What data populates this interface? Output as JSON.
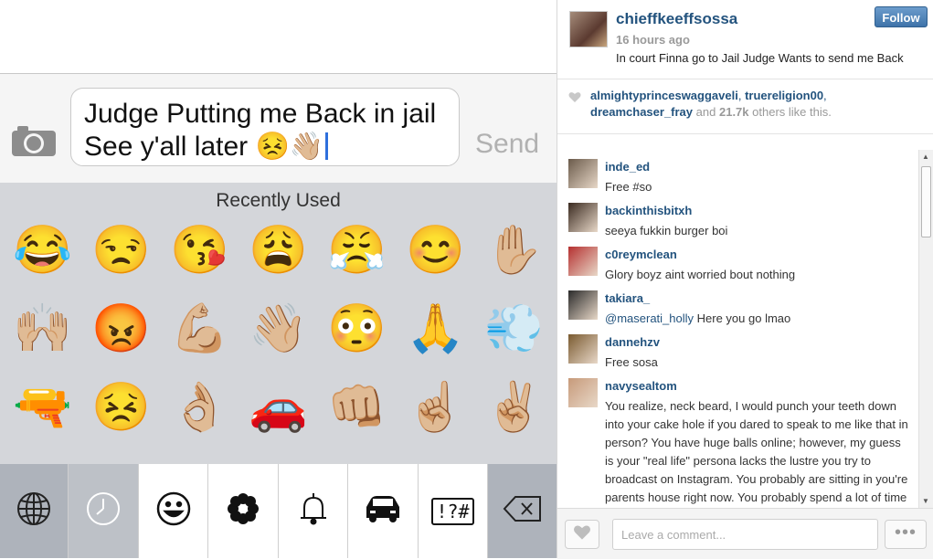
{
  "compose": {
    "message_text": "Judge Putting me Back in jail See y'all later 😣👋🏼",
    "send_label": "Send"
  },
  "emoji_panel": {
    "section_label": "Recently Used",
    "emojis": [
      "😂",
      "😒",
      "😘",
      "😩",
      "😤",
      "😊",
      "✋🏼",
      "🙌🏼",
      "😡",
      "💪🏼",
      "👋🏼",
      "😳",
      "🙏",
      "💨",
      "🔫",
      "😣",
      "👌🏼",
      "🚗",
      "👊🏼",
      "☝🏼",
      "✌🏼"
    ]
  },
  "keyboard_bar": {
    "keys": [
      {
        "icon": "globe-icon"
      },
      {
        "icon": "recent-clock-icon"
      },
      {
        "icon": "smiley-icon"
      },
      {
        "icon": "flower-icon"
      },
      {
        "icon": "bell-icon"
      },
      {
        "icon": "car-icon"
      },
      {
        "icon": "symbols-icon",
        "label": "!?#"
      },
      {
        "icon": "delete-icon"
      }
    ]
  },
  "post": {
    "username": "chieffkeeffsossa",
    "time": "16 hours ago",
    "caption": "In court Finna go to Jail Judge Wants to send me Back",
    "follow_label": "Follow",
    "likes": {
      "user1": "almightyprinceswaggaveli",
      "user2": "truereligion00",
      "user3": "dreamchaser_fray",
      "mid": "and",
      "count": "21.7k",
      "suffix": "others like this."
    }
  },
  "comments": [
    {
      "user": "inde_ed",
      "text": "Free #so",
      "avatar_color": "#6a5a4a"
    },
    {
      "user": "backinthisbitxh",
      "text": "seeya fukkin burger boi",
      "avatar_color": "#3a2a20"
    },
    {
      "user": "c0reymclean",
      "text": "Glory boyz aint worried bout nothing",
      "avatar_color": "#b53030"
    },
    {
      "user": "takiara_",
      "mention": "@maserati_holly",
      "text": "Here you go lmao",
      "avatar_color": "#2a2a2a"
    },
    {
      "user": "dannehzv",
      "text": "Free sosa",
      "avatar_color": "#7a5a30"
    },
    {
      "user": "navysealtom",
      "text": "You realize, neck beard, I would punch your teeth down into your cake hole if you dared to speak to me like that in person? You have huge balls online; however, my guess is your \"real life\" persona lacks the lustre you try to broadcast on Instagram. You probably are sitting in you're parents house right now. You probably spend a lot of time on the couch with",
      "avatar_color": "#c79a7a"
    }
  ],
  "comment_box": {
    "placeholder": "Leave a comment...",
    "more_label": "•••"
  }
}
